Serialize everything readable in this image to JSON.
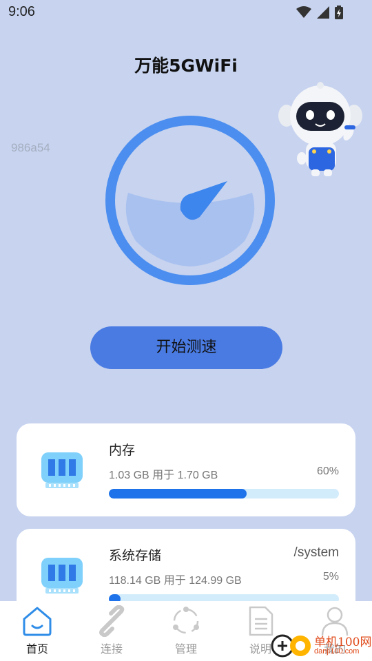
{
  "status_bar": {
    "time": "9:06",
    "icons": [
      "wifi-icon",
      "cell-signal-icon",
      "battery-charging-icon"
    ]
  },
  "app": {
    "title": "万能5GWiFi",
    "device_id": "986a54"
  },
  "colors": {
    "background": "#c7d3ef",
    "accent": "#4a7be3",
    "gauge_ring": "#4b8ef0",
    "progress_fill": "#1e72ea",
    "progress_track": "#d3ecfb"
  },
  "speed_test": {
    "button_label": "开始测速"
  },
  "storage_cards": [
    {
      "title": "内存",
      "path": "",
      "usage_text": "1.03 GB 用于 1.70 GB",
      "percent_label": "60%",
      "fraction": 0.6,
      "icon": "ram-chip-icon"
    },
    {
      "title": "系统存储",
      "path": "/system",
      "usage_text": "118.14 GB 用于 124.99 GB",
      "percent_label": "5%",
      "fraction": 0.05,
      "icon": "storage-chip-icon"
    }
  ],
  "bottom_nav": {
    "items": [
      {
        "label": "首页",
        "icon": "home-icon",
        "active": true
      },
      {
        "label": "连接",
        "icon": "link-icon",
        "active": false
      },
      {
        "label": "管理",
        "icon": "manage-icon",
        "active": false
      },
      {
        "label": "说明",
        "icon": "document-icon",
        "active": false
      },
      {
        "label": "我的",
        "icon": "user-icon",
        "active": false
      }
    ]
  },
  "watermark": {
    "brand": "单机100网",
    "url": "danji100.com"
  }
}
